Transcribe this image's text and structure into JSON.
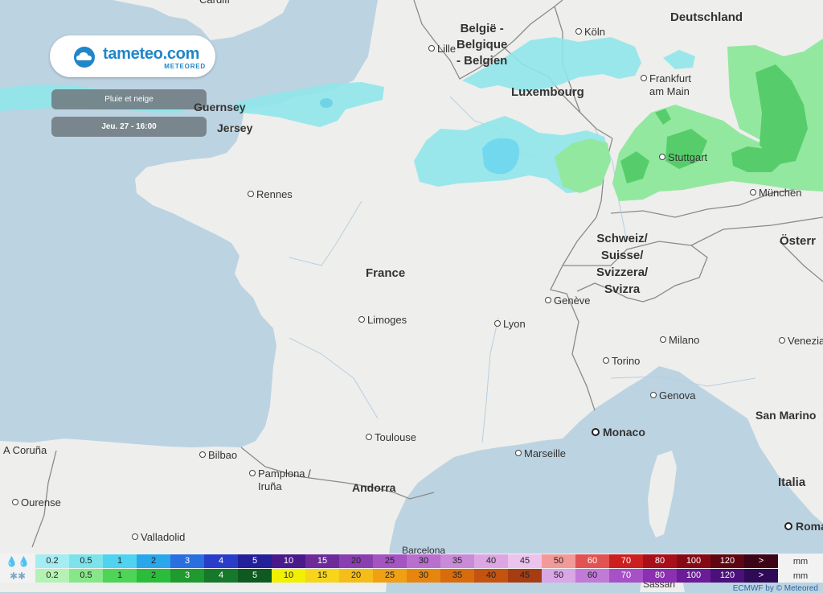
{
  "brand": {
    "name": "tameteo.com",
    "sub": "METEORED"
  },
  "layer_label": "Pluie et neige",
  "datetime_label": "Jeu. 27 - 16:00",
  "colors": {
    "sea": "#bcd3e2",
    "land": "#eeeeec",
    "rain_light": "#8fe6ea",
    "snow_light": "#92e89f",
    "snow_mid": "#56cd6a",
    "brand": "#1f86c9"
  },
  "countries": [
    {
      "id": "belgium",
      "lines": [
        "België -",
        "Belgique",
        "- Belgien"
      ]
    },
    {
      "id": "germany",
      "lines": [
        "Deutschland"
      ]
    },
    {
      "id": "luxembourg",
      "lines": [
        "Luxembourg"
      ]
    },
    {
      "id": "france",
      "lines": [
        "France"
      ]
    },
    {
      "id": "switzerland",
      "lines": [
        "Schweiz/",
        "Suisse/",
        "Svizzera/",
        "Svizra"
      ]
    },
    {
      "id": "austria",
      "lines": [
        "Österr"
      ]
    },
    {
      "id": "guernsey",
      "lines": [
        "Guernsey"
      ]
    },
    {
      "id": "jersey",
      "lines": [
        "Jersey"
      ]
    },
    {
      "id": "andorra",
      "lines": [
        "Andorra"
      ]
    },
    {
      "id": "san-marino",
      "lines": [
        "San Marino"
      ]
    },
    {
      "id": "italia",
      "lines": [
        "Italia"
      ]
    }
  ],
  "cities": [
    {
      "id": "cardiff",
      "name": "Cardiff"
    },
    {
      "id": "lille",
      "name": "Lille"
    },
    {
      "id": "koln",
      "name": "Köln"
    },
    {
      "id": "frankfurt",
      "name": "Frankfurt am Main"
    },
    {
      "id": "stuttgart",
      "name": "Stuttgart"
    },
    {
      "id": "munchen",
      "name": "München"
    },
    {
      "id": "rennes",
      "name": "Rennes"
    },
    {
      "id": "limoges",
      "name": "Limoges"
    },
    {
      "id": "lyon",
      "name": "Lyon"
    },
    {
      "id": "geneve",
      "name": "Genève"
    },
    {
      "id": "milano",
      "name": "Milano"
    },
    {
      "id": "venezia",
      "name": "Venezia"
    },
    {
      "id": "torino",
      "name": "Torino"
    },
    {
      "id": "genova",
      "name": "Genova"
    },
    {
      "id": "toulouse",
      "name": "Toulouse"
    },
    {
      "id": "marseille",
      "name": "Marseille"
    },
    {
      "id": "bilbao",
      "name": "Bilbao"
    },
    {
      "id": "pamplona",
      "name": "Pamplona / Iruña"
    },
    {
      "id": "acoruna",
      "name": "A Coruña"
    },
    {
      "id": "ourense",
      "name": "Ourense"
    },
    {
      "id": "valladolid",
      "name": "Valladolid"
    },
    {
      "id": "barcelona",
      "name": "Barcelona"
    },
    {
      "id": "sassari",
      "name": "Sassari"
    }
  ],
  "capitals": [
    {
      "id": "monaco",
      "name": "Monaco"
    },
    {
      "id": "roma",
      "name": "Roma"
    }
  ],
  "legend": {
    "unit": "mm",
    "values": [
      "0.2",
      "0.5",
      "1",
      "2",
      "3",
      "4",
      "5",
      "10",
      "15",
      "20",
      "25",
      "30",
      "35",
      "40",
      "45",
      "50",
      "60",
      "70",
      "80",
      "100",
      "120",
      ">"
    ],
    "rain_colors": [
      "#a4edf2",
      "#7de3ea",
      "#4ed3f0",
      "#2aa6ea",
      "#2a6fe0",
      "#2a3dc8",
      "#232099",
      "#4a1a8a",
      "#6d2b9a",
      "#8a3fb0",
      "#a455c2",
      "#b86fce",
      "#c98ad8",
      "#dca6e2",
      "#ecc3ec",
      "#f29a9a",
      "#e25252",
      "#cc1f1f",
      "#a80f1a",
      "#850a16",
      "#5e0612",
      "#3d0418"
    ],
    "snow_colors": [
      "#b4f2b4",
      "#86e688",
      "#4ed457",
      "#2cbc3c",
      "#1f9a2e",
      "#15782a",
      "#0e5a20",
      "#f0f000",
      "#f6d51a",
      "#f5bd1a",
      "#f0a013",
      "#e6860e",
      "#d86c0c",
      "#c45310",
      "#a63d12",
      "#d9a6e6",
      "#c27ad8",
      "#a850c6",
      "#8a30b0",
      "#6a1d96",
      "#4b107a",
      "#2f0a56"
    ]
  },
  "credit": "ECMWF by © Meteored"
}
